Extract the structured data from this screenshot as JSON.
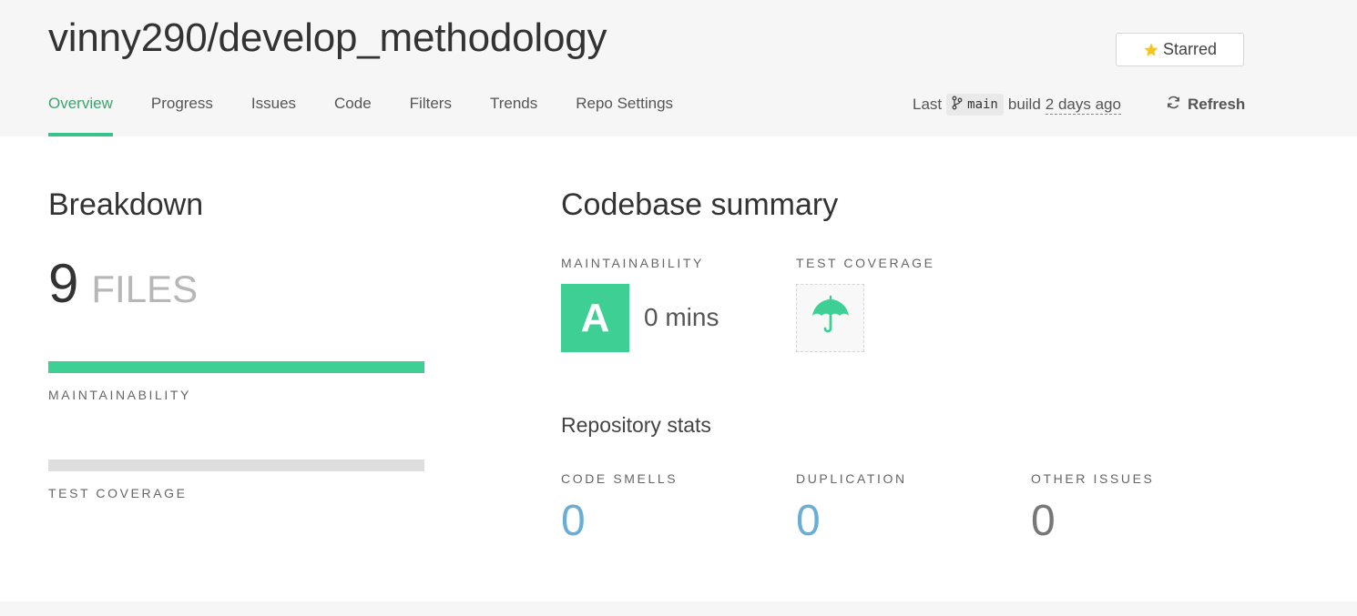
{
  "header": {
    "repo_title": "vinny290/develop_methodology",
    "star_button": {
      "label": "Starred",
      "icon": "star-icon",
      "icon_color": "#f5c518"
    },
    "tabs": [
      {
        "label": "Overview",
        "active": true
      },
      {
        "label": "Progress",
        "active": false
      },
      {
        "label": "Issues",
        "active": false
      },
      {
        "label": "Code",
        "active": false
      },
      {
        "label": "Filters",
        "active": false
      },
      {
        "label": "Trends",
        "active": false
      },
      {
        "label": "Repo Settings",
        "active": false
      }
    ],
    "build": {
      "prefix": "Last",
      "branch": "main",
      "branch_icon": "git-branch-icon",
      "middle": "build",
      "time": "2 days ago"
    },
    "refresh": {
      "label": "Refresh",
      "icon": "refresh-icon"
    }
  },
  "breakdown": {
    "title": "Breakdown",
    "files_count": "9",
    "files_label": "FILES",
    "maintainability": {
      "label": "MAINTAINABILITY",
      "fill_fraction": 1.0,
      "color": "#3ecf95"
    },
    "test_coverage": {
      "label": "TEST COVERAGE",
      "fill_fraction": 0.0
    }
  },
  "summary": {
    "title": "Codebase summary",
    "maintainability": {
      "label": "MAINTAINABILITY",
      "grade": "A",
      "time": "0 mins",
      "color": "#3ecf95"
    },
    "test_coverage": {
      "label": "TEST COVERAGE",
      "icon": "umbrella-icon"
    },
    "repo_stats": {
      "title": "Repository stats",
      "code_smells": {
        "label": "CODE SMELLS",
        "value": "0",
        "color": "#6aaed6"
      },
      "duplication": {
        "label": "DUPLICATION",
        "value": "0",
        "color": "#6aaed6"
      },
      "other_issues": {
        "label": "OTHER ISSUES",
        "value": "0",
        "color": "#777777"
      }
    }
  },
  "colors": {
    "accent_green": "#3ecf95",
    "header_bg": "#f6f6f6",
    "active_tab_text": "#3fa36f"
  }
}
